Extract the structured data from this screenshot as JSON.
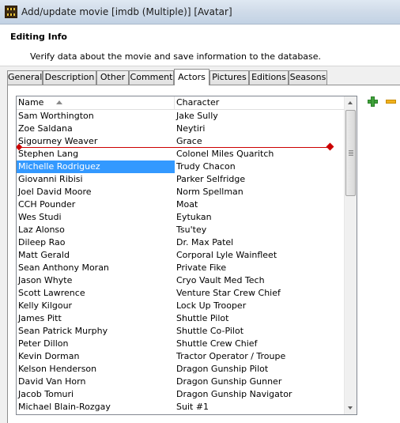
{
  "window": {
    "title": "Add/update movie [imdb (Multiple)] [Avatar]",
    "icon": "film-clapper-icon"
  },
  "header": {
    "title": "Editing Info",
    "subtitle": "Verify data about the movie and save information to the database."
  },
  "tabs": [
    {
      "label": "General"
    },
    {
      "label": "Description"
    },
    {
      "label": "Other"
    },
    {
      "label": "Comment"
    },
    {
      "label": "Actors",
      "active": true
    },
    {
      "label": "Pictures"
    },
    {
      "label": "Editions"
    },
    {
      "label": "Seasons"
    }
  ],
  "actors": {
    "columns": {
      "name": "Name",
      "character": "Character"
    },
    "sort": {
      "column": "Name",
      "direction": "ascending"
    },
    "selected_row": 4,
    "rows": [
      {
        "name": "Sam Worthington",
        "character": "Jake Sully"
      },
      {
        "name": "Zoe Saldana",
        "character": "Neytiri"
      },
      {
        "name": "Sigourney Weaver",
        "character": "Grace"
      },
      {
        "name": "Stephen Lang",
        "character": "Colonel Miles Quaritch"
      },
      {
        "name": "Michelle Rodriguez",
        "character": "Trudy Chacon"
      },
      {
        "name": "Giovanni Ribisi",
        "character": "Parker Selfridge"
      },
      {
        "name": "Joel David Moore",
        "character": "Norm Spellman"
      },
      {
        "name": "CCH Pounder",
        "character": "Moat"
      },
      {
        "name": "Wes Studi",
        "character": "Eytukan"
      },
      {
        "name": "Laz Alonso",
        "character": "Tsu'tey"
      },
      {
        "name": "Dileep Rao",
        "character": "Dr. Max Patel"
      },
      {
        "name": "Matt Gerald",
        "character": "Corporal Lyle Wainfleet"
      },
      {
        "name": "Sean Anthony Moran",
        "character": "Private Fike"
      },
      {
        "name": "Jason Whyte",
        "character": "Cryo Vault Med Tech"
      },
      {
        "name": "Scott Lawrence",
        "character": "Venture Star Crew Chief"
      },
      {
        "name": "Kelly Kilgour",
        "character": "Lock Up Trooper"
      },
      {
        "name": "James Pitt",
        "character": "Shuttle Pilot"
      },
      {
        "name": "Sean Patrick Murphy",
        "character": "Shuttle Co-Pilot"
      },
      {
        "name": "Peter Dillon",
        "character": "Shuttle Crew Chief"
      },
      {
        "name": "Kevin Dorman",
        "character": "Tractor Operator / Troupe"
      },
      {
        "name": "Kelson Henderson",
        "character": "Dragon Gunship Pilot"
      },
      {
        "name": "David Van Horn",
        "character": "Dragon Gunship Gunner"
      },
      {
        "name": "Jacob Tomuri",
        "character": "Dragon Gunship Navigator"
      },
      {
        "name": "Michael Blain-Rozgay",
        "character": "Suit #1"
      }
    ]
  },
  "side_buttons": {
    "add_icon": "plus-icon",
    "remove_icon": "minus-icon"
  },
  "colors": {
    "selection": "#3399ff",
    "drag_marker": "#cc0000",
    "add": "#3fa23a",
    "remove": "#f0b21e"
  }
}
